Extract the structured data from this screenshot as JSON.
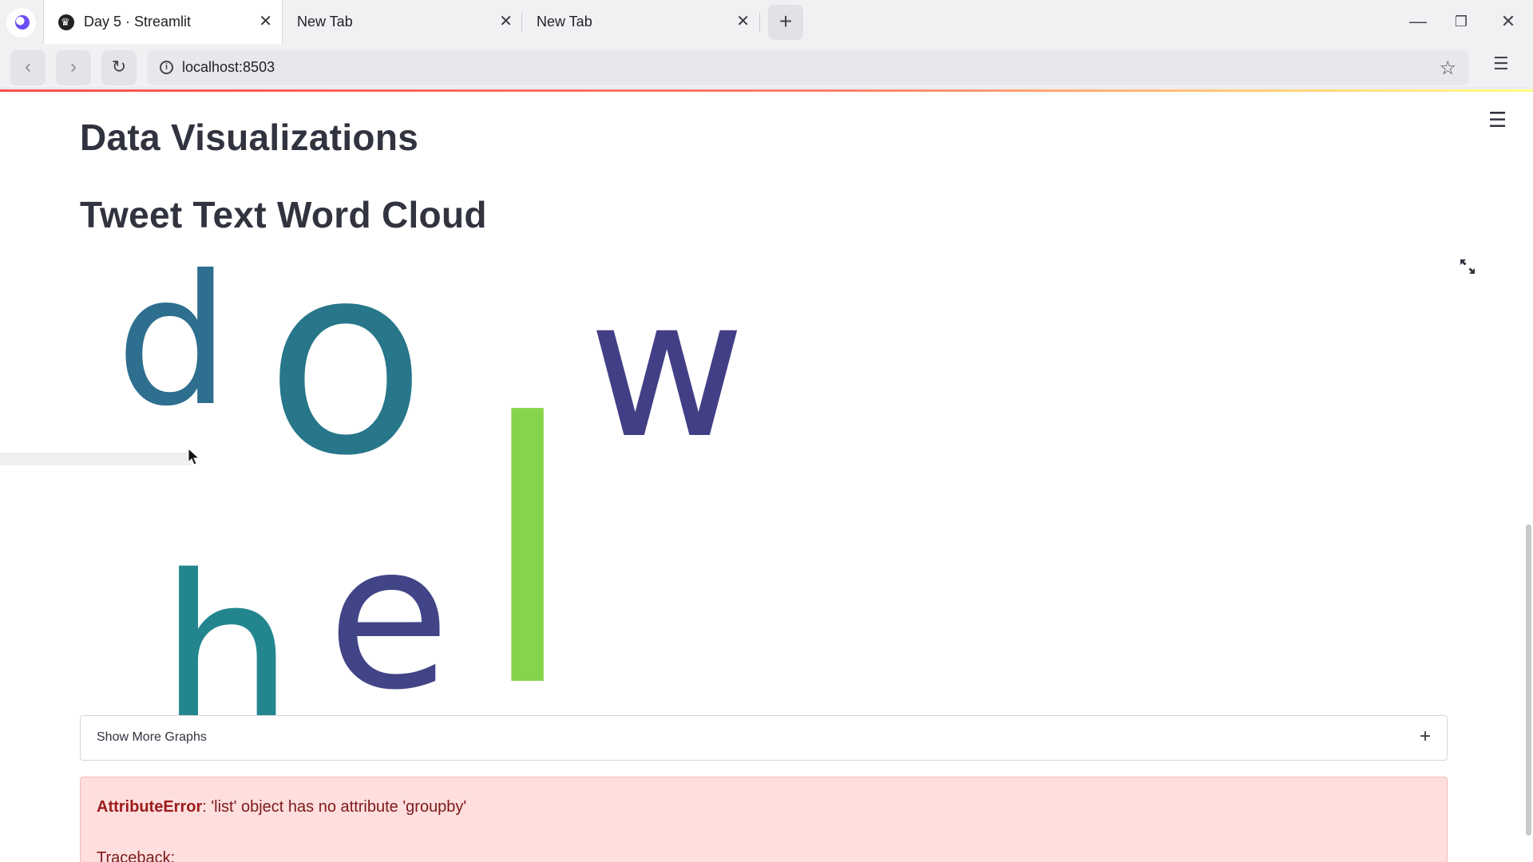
{
  "browser": {
    "tabs": [
      {
        "title": "Day 5 · Streamlit",
        "active": true
      },
      {
        "title": "New Tab",
        "active": false
      },
      {
        "title": "New Tab",
        "active": false
      }
    ],
    "url": "localhost:8503",
    "icons": [
      "back-icon",
      "forward-icon",
      "reload-icon",
      "info-icon",
      "star-icon",
      "sidebar-menu-icon",
      "minimize-icon",
      "restore-icon",
      "close-icon",
      "new-tab-icon"
    ]
  },
  "page": {
    "title": "Data Visualizations",
    "subtitle": "Tweet Text Word Cloud",
    "wordcloud": {
      "words": [
        {
          "text": "d",
          "color": "#2e6e8e"
        },
        {
          "text": "o",
          "color": "#27768a"
        },
        {
          "text": "l",
          "color": "#86d44b"
        },
        {
          "text": "w",
          "color": "#433f86"
        },
        {
          "text": "h",
          "color": "#23868e"
        },
        {
          "text": "e",
          "color": "#414487"
        }
      ]
    },
    "expander": {
      "label": "Show More Graphs",
      "expand_symbol": "+"
    },
    "error": {
      "name": "AttributeError",
      "message": ": 'list' object has no attribute 'groupby'",
      "traceback": "Traceback:"
    },
    "accent_color": "#ff4b4b"
  }
}
